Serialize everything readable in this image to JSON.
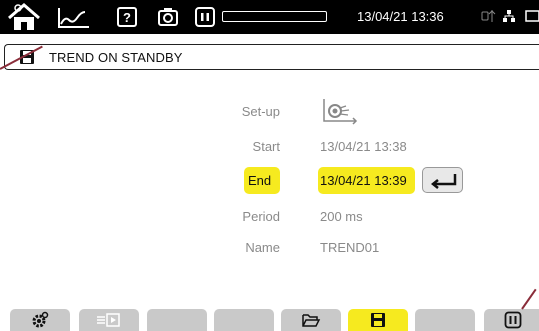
{
  "status_bar": {
    "datetime": "13/04/21 13:36",
    "icons": [
      "home-icon",
      "trend-icon",
      "help-icon",
      "camera-icon",
      "pause-icon",
      "progress-bar",
      "usb-icon",
      "network-icon",
      "battery-icon"
    ],
    "progress": 0
  },
  "title_bar": {
    "icon": "floppy-disk-icon",
    "title": "TREND ON STANDBY"
  },
  "form": {
    "setup": {
      "label": "Set-up",
      "icon": "trend-config-icon"
    },
    "start": {
      "label": "Start",
      "value": "13/04/21 13:38"
    },
    "end": {
      "label": "End",
      "value": "13/04/21 13:39"
    },
    "period": {
      "label": "Period",
      "value": "200 ms"
    },
    "name": {
      "label": "Name",
      "value": "TREND01"
    }
  },
  "enter_button": {
    "icon": "enter-return-icon"
  },
  "bottom_tabs": [
    {
      "icon": "settings-gear-icon",
      "active": false
    },
    {
      "icon": "sequence-play-icon",
      "active": false
    },
    {
      "icon": "",
      "active": false
    },
    {
      "icon": "",
      "active": false
    },
    {
      "icon": "open-folder-icon",
      "active": false
    },
    {
      "icon": "save-floppy-icon",
      "active": true
    },
    {
      "icon": "",
      "active": false
    },
    {
      "icon": "pause-icon",
      "active": false
    }
  ],
  "colors": {
    "accent": "#f6ea1f",
    "tab": "#c9c9c9",
    "label": "#8a8a8a",
    "leader": "#8a2d3a"
  }
}
